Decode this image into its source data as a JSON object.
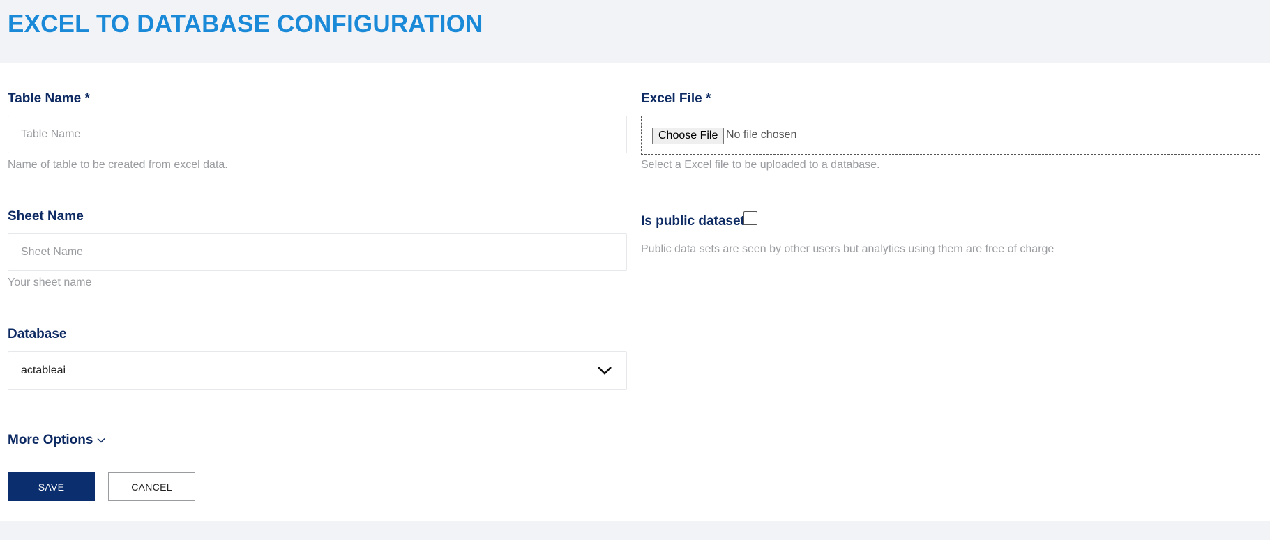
{
  "page": {
    "title": "EXCEL TO DATABASE CONFIGURATION"
  },
  "table_name": {
    "label": "Table Name *",
    "placeholder": "Table Name",
    "value": "",
    "help": "Name of table to be created from excel data."
  },
  "sheet_name": {
    "label": "Sheet Name",
    "placeholder": "Sheet Name",
    "value": "",
    "help": "Your sheet name"
  },
  "database": {
    "label": "Database",
    "selected": "actableai"
  },
  "excel_file": {
    "label": "Excel File *",
    "button_label": "Choose File",
    "status": "No file chosen",
    "help": "Select a Excel file to be uploaded to a database."
  },
  "public_dataset": {
    "label": "Is public dataset",
    "checked": false,
    "help": "Public data sets are seen by other users but analytics using them are free of charge"
  },
  "more_options": {
    "label": "More Options"
  },
  "actions": {
    "save_label": "SAVE",
    "cancel_label": "CANCEL"
  },
  "colors": {
    "title": "#1a8ad8",
    "label": "#0d2a63",
    "primary_button": "#0b2e6e",
    "help_text": "#9a9ca0",
    "background": "#f1f3f6"
  }
}
